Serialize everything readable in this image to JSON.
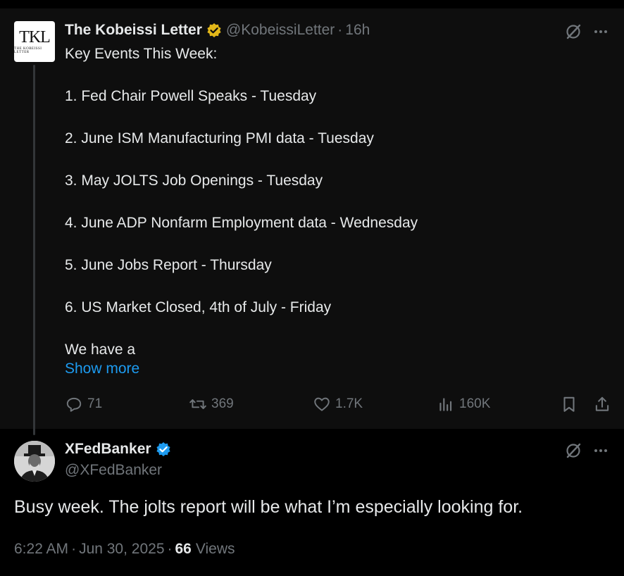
{
  "tweet": {
    "author_name": "The Kobeissi Letter",
    "author_handle": "@KobeissiLetter",
    "separator": "·",
    "time": "16h",
    "avatar_text": "TKL",
    "avatar_subtext": "THE KOBEISSI LETTER",
    "lines": [
      "Key Events This Week:",
      "1. Fed Chair Powell Speaks - Tuesday",
      "2. June ISM Manufacturing PMI data - Tuesday",
      "3. May JOLTS Job Openings - Tuesday",
      "4. June ADP Nonfarm Employment data - Wednesday",
      "5. June Jobs Report - Thursday",
      "6. US Market Closed, 4th of July - Friday",
      "We have a"
    ],
    "show_more": "Show more",
    "stats": {
      "replies": "71",
      "reposts": "369",
      "likes": "1.7K",
      "views": "160K"
    },
    "verified_color": "#e2b719"
  },
  "reply": {
    "author_name": "XFedBanker",
    "author_handle": "@XFedBanker",
    "text": "Busy week.  The jolts report will be what I’m especially looking for.",
    "time": "6:22 AM",
    "date": "Jun 30, 2025",
    "separator": "·",
    "views_count": "66",
    "views_label": "Views",
    "verified_color": "#1d9bf0"
  },
  "icons": {
    "grok": "grok-icon",
    "more": "more-icon",
    "reply": "reply-icon",
    "repost": "repost-icon",
    "like": "heart-icon",
    "views": "views-icon",
    "bookmark": "bookmark-icon",
    "share": "share-icon"
  },
  "colors": {
    "background": "#000000",
    "card": "#0e0e0e",
    "text": "#e7e9ea",
    "muted": "#71767b",
    "link": "#1d9bf0"
  }
}
